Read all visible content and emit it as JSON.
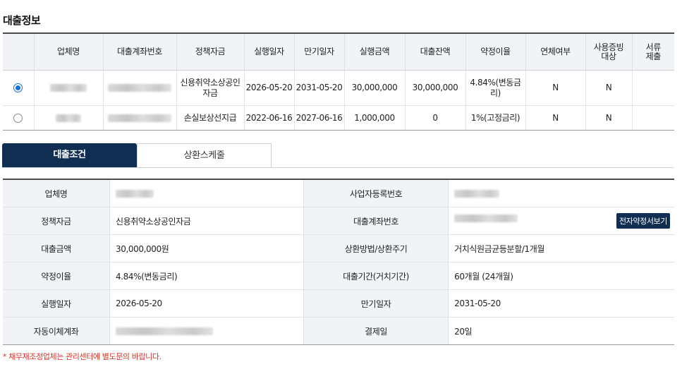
{
  "section_title": "대출정보",
  "loan_table": {
    "headers": [
      "",
      "업체명",
      "대출계좌번호",
      "정책자금",
      "실행일자",
      "만기일자",
      "실행금액",
      "대출잔액",
      "약정이율",
      "연체여부",
      "사용증빙\n대상",
      "서류\n제출"
    ],
    "rows": [
      {
        "selected": true,
        "policy_fund": "신용취약소상공인자금",
        "exec_date": "2026-05-20",
        "maturity_date": "2031-05-20",
        "exec_amount": "30,000,000",
        "balance": "30,000,000",
        "rate": "4.84%(변동금리)",
        "overdue": "N",
        "proof_target": "N"
      },
      {
        "selected": false,
        "policy_fund": "손실보상선지급",
        "exec_date": "2022-06-16",
        "maturity_date": "2027-06-16",
        "exec_amount": "1,000,000",
        "balance": "0",
        "rate": "1%(고정금리)",
        "overdue": "N",
        "proof_target": "N"
      }
    ]
  },
  "tabs": {
    "active": "대출조건",
    "inactive": "상환스케줄"
  },
  "detail": {
    "company_label": "업체명",
    "bizno_label": "사업자등록번호",
    "policy_fund_label": "정책자금",
    "policy_fund_value": "신용취약소상공인자금",
    "account_label": "대출계좌번호",
    "contract_button": "전자약정서보기",
    "amount_label": "대출금액",
    "amount_value": "30,000,000원",
    "repay_method_label": "상환방법/상환주기",
    "repay_method_value": "거치식원금균등분할/1개월",
    "rate_label": "약정이율",
    "rate_value": "4.84%(변동금리)",
    "period_label": "대출기간(거치기간)",
    "period_value": "60개월 (24개월)",
    "exec_date_label": "실행일자",
    "exec_date_value": "2026-05-20",
    "maturity_label": "만기일자",
    "maturity_value": "2031-05-20",
    "auto_transfer_label": "자동이체계좌",
    "payment_day_label": "결제일",
    "payment_day_value": "20일"
  },
  "footnote": "* 채무재조정업체는 관리센터에 별도문의 바랍니다.",
  "colors": {
    "accent_navy": "#0f2e52",
    "radio_blue": "#1b6fd6",
    "note_red": "#d2352b"
  }
}
